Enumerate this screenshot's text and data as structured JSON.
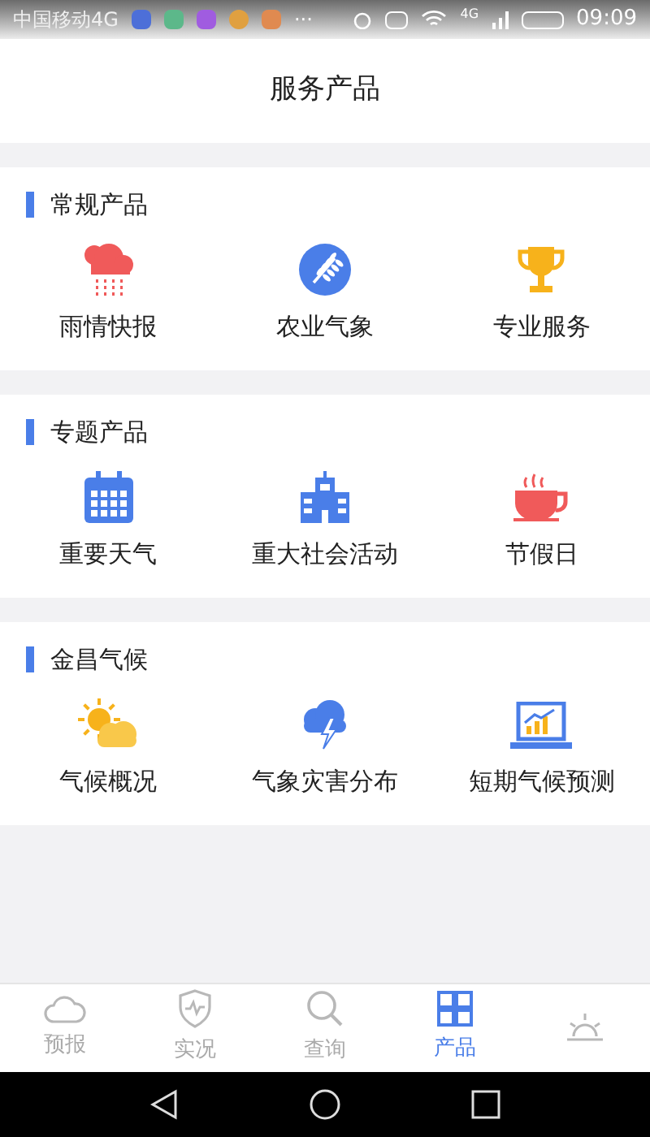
{
  "status_bar": {
    "carrier": "中国移动4G",
    "dots": "···",
    "network": "4G",
    "time": "09:09"
  },
  "header": {
    "title": "服务产品"
  },
  "sections": [
    {
      "title": "常规产品",
      "items": [
        {
          "label": "雨情快报"
        },
        {
          "label": "农业气象"
        },
        {
          "label": "专业服务"
        }
      ]
    },
    {
      "title": "专题产品",
      "items": [
        {
          "label": "重要天气"
        },
        {
          "label": "重大社会活动"
        },
        {
          "label": "节假日"
        }
      ]
    },
    {
      "title": "金昌气候",
      "items": [
        {
          "label": "气候概况"
        },
        {
          "label": "气象灾害分布"
        },
        {
          "label": "短期气候预测"
        }
      ]
    }
  ],
  "tab_bar": [
    {
      "label": "预报",
      "selected": false
    },
    {
      "label": "实况",
      "selected": false
    },
    {
      "label": "查询",
      "selected": false
    },
    {
      "label": "产品",
      "selected": true
    },
    {
      "selected": false
    }
  ]
}
